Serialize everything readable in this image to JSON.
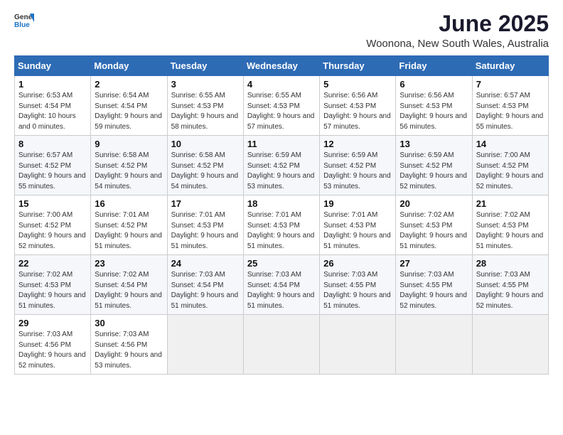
{
  "header": {
    "logo_general": "General",
    "logo_blue": "Blue",
    "month": "June 2025",
    "location": "Woonona, New South Wales, Australia"
  },
  "weekdays": [
    "Sunday",
    "Monday",
    "Tuesday",
    "Wednesday",
    "Thursday",
    "Friday",
    "Saturday"
  ],
  "weeks": [
    [
      {
        "day": "1",
        "sunrise": "6:53 AM",
        "sunset": "4:54 PM",
        "daylight": "10 hours and 0 minutes."
      },
      {
        "day": "2",
        "sunrise": "6:54 AM",
        "sunset": "4:54 PM",
        "daylight": "9 hours and 59 minutes."
      },
      {
        "day": "3",
        "sunrise": "6:55 AM",
        "sunset": "4:53 PM",
        "daylight": "9 hours and 58 minutes."
      },
      {
        "day": "4",
        "sunrise": "6:55 AM",
        "sunset": "4:53 PM",
        "daylight": "9 hours and 57 minutes."
      },
      {
        "day": "5",
        "sunrise": "6:56 AM",
        "sunset": "4:53 PM",
        "daylight": "9 hours and 57 minutes."
      },
      {
        "day": "6",
        "sunrise": "6:56 AM",
        "sunset": "4:53 PM",
        "daylight": "9 hours and 56 minutes."
      },
      {
        "day": "7",
        "sunrise": "6:57 AM",
        "sunset": "4:53 PM",
        "daylight": "9 hours and 55 minutes."
      }
    ],
    [
      {
        "day": "8",
        "sunrise": "6:57 AM",
        "sunset": "4:52 PM",
        "daylight": "9 hours and 55 minutes."
      },
      {
        "day": "9",
        "sunrise": "6:58 AM",
        "sunset": "4:52 PM",
        "daylight": "9 hours and 54 minutes."
      },
      {
        "day": "10",
        "sunrise": "6:58 AM",
        "sunset": "4:52 PM",
        "daylight": "9 hours and 54 minutes."
      },
      {
        "day": "11",
        "sunrise": "6:59 AM",
        "sunset": "4:52 PM",
        "daylight": "9 hours and 53 minutes."
      },
      {
        "day": "12",
        "sunrise": "6:59 AM",
        "sunset": "4:52 PM",
        "daylight": "9 hours and 53 minutes."
      },
      {
        "day": "13",
        "sunrise": "6:59 AM",
        "sunset": "4:52 PM",
        "daylight": "9 hours and 52 minutes."
      },
      {
        "day": "14",
        "sunrise": "7:00 AM",
        "sunset": "4:52 PM",
        "daylight": "9 hours and 52 minutes."
      }
    ],
    [
      {
        "day": "15",
        "sunrise": "7:00 AM",
        "sunset": "4:52 PM",
        "daylight": "9 hours and 52 minutes."
      },
      {
        "day": "16",
        "sunrise": "7:01 AM",
        "sunset": "4:52 PM",
        "daylight": "9 hours and 51 minutes."
      },
      {
        "day": "17",
        "sunrise": "7:01 AM",
        "sunset": "4:53 PM",
        "daylight": "9 hours and 51 minutes."
      },
      {
        "day": "18",
        "sunrise": "7:01 AM",
        "sunset": "4:53 PM",
        "daylight": "9 hours and 51 minutes."
      },
      {
        "day": "19",
        "sunrise": "7:01 AM",
        "sunset": "4:53 PM",
        "daylight": "9 hours and 51 minutes."
      },
      {
        "day": "20",
        "sunrise": "7:02 AM",
        "sunset": "4:53 PM",
        "daylight": "9 hours and 51 minutes."
      },
      {
        "day": "21",
        "sunrise": "7:02 AM",
        "sunset": "4:53 PM",
        "daylight": "9 hours and 51 minutes."
      }
    ],
    [
      {
        "day": "22",
        "sunrise": "7:02 AM",
        "sunset": "4:53 PM",
        "daylight": "9 hours and 51 minutes."
      },
      {
        "day": "23",
        "sunrise": "7:02 AM",
        "sunset": "4:54 PM",
        "daylight": "9 hours and 51 minutes."
      },
      {
        "day": "24",
        "sunrise": "7:03 AM",
        "sunset": "4:54 PM",
        "daylight": "9 hours and 51 minutes."
      },
      {
        "day": "25",
        "sunrise": "7:03 AM",
        "sunset": "4:54 PM",
        "daylight": "9 hours and 51 minutes."
      },
      {
        "day": "26",
        "sunrise": "7:03 AM",
        "sunset": "4:55 PM",
        "daylight": "9 hours and 51 minutes."
      },
      {
        "day": "27",
        "sunrise": "7:03 AM",
        "sunset": "4:55 PM",
        "daylight": "9 hours and 52 minutes."
      },
      {
        "day": "28",
        "sunrise": "7:03 AM",
        "sunset": "4:55 PM",
        "daylight": "9 hours and 52 minutes."
      }
    ],
    [
      {
        "day": "29",
        "sunrise": "7:03 AM",
        "sunset": "4:56 PM",
        "daylight": "9 hours and 52 minutes."
      },
      {
        "day": "30",
        "sunrise": "7:03 AM",
        "sunset": "4:56 PM",
        "daylight": "9 hours and 53 minutes."
      },
      null,
      null,
      null,
      null,
      null
    ]
  ]
}
